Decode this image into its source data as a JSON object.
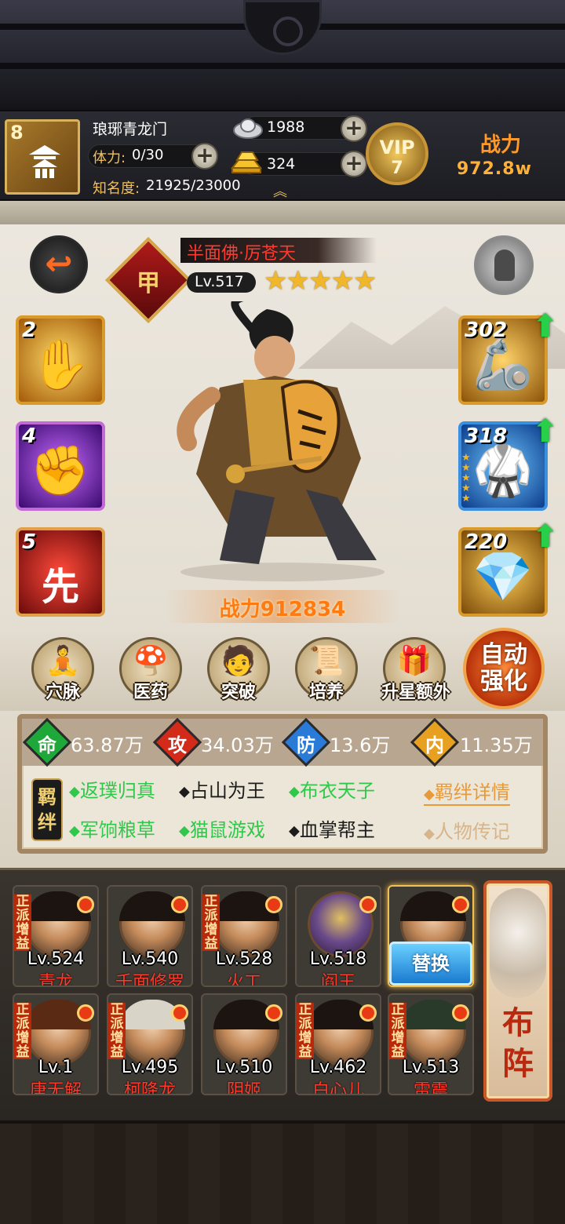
{
  "player": {
    "level": "8",
    "name": "琅琊青龙门",
    "stamina_label": "体力:",
    "stamina_value": "0/30",
    "fame_label": "知名度:",
    "fame_value": "21925/23000"
  },
  "currency": {
    "silver": "1988",
    "gold": "324"
  },
  "vip": {
    "label": "VIP",
    "level": "7"
  },
  "header_power": {
    "label": "战力",
    "value": "972.8w"
  },
  "hero": {
    "rank": "甲",
    "name": "半面佛·厉苍天",
    "level": "Lv.517",
    "stars": 5,
    "power": "战力912834"
  },
  "skills": [
    {
      "level": "2",
      "icon": "palm-icon",
      "glyph": "✋"
    },
    {
      "level": "4",
      "icon": "fist-icon",
      "glyph": "✊"
    },
    {
      "level": "5",
      "icon": "first-strike-icon",
      "glyph": "先"
    }
  ],
  "equipment": [
    {
      "level": "302",
      "icon": "gauntlet-icon",
      "glyph": "🦾"
    },
    {
      "level": "318",
      "icon": "robe-icon",
      "glyph": "🥋"
    },
    {
      "level": "220",
      "icon": "gems-icon",
      "glyph": "💎"
    }
  ],
  "functions": [
    {
      "label": "穴脉",
      "icon": "meridian-icon",
      "glyph": "🧘"
    },
    {
      "label": "医药",
      "icon": "medicine-icon",
      "glyph": "🍄"
    },
    {
      "label": "突破",
      "icon": "breakthrough-icon",
      "glyph": "🧑"
    },
    {
      "label": "培养",
      "icon": "cultivate-icon",
      "glyph": "📜"
    },
    {
      "label": "升星额外",
      "icon": "star-upgrade-icon",
      "glyph": "🎁"
    }
  ],
  "auto_enhance": {
    "line1": "自动",
    "line2": "强化"
  },
  "stats": [
    {
      "icon": "命",
      "value": "63.87万",
      "color": "#1fa83a"
    },
    {
      "icon": "攻",
      "value": "34.03万",
      "color": "#d42a1a"
    },
    {
      "icon": "防",
      "value": "13.6万",
      "color": "#2a7ad8"
    },
    {
      "icon": "内",
      "value": "11.35万",
      "color": "#e8a020"
    }
  ],
  "bonds": {
    "badge_top": "羁",
    "badge_bottom": "绊",
    "items": [
      {
        "text": "返璞归真",
        "active": true
      },
      {
        "text": "占山为王",
        "active": false
      },
      {
        "text": "布衣天子",
        "active": true
      },
      {
        "text": "军饷粮草",
        "active": true
      },
      {
        "text": "猫鼠游戏",
        "active": true
      },
      {
        "text": "血掌帮主",
        "active": false
      }
    ],
    "details_link": "羁绊详情",
    "biography_link": "人物传记"
  },
  "team": [
    {
      "level": "Lv.524",
      "name": "青龙",
      "tag": "正派增益"
    },
    {
      "level": "Lv.540",
      "name": "千面修罗",
      "tag": ""
    },
    {
      "level": "Lv.528",
      "name": "火工",
      "tag": "正派增益"
    },
    {
      "level": "Lv.518",
      "name": "阎王",
      "tag": ""
    },
    {
      "level": "",
      "name": "",
      "tag": ""
    },
    {
      "level": "Lv.1",
      "name": "唐无解",
      "tag": "正派增益"
    },
    {
      "level": "Lv.495",
      "name": "柯降龙",
      "tag": "正派增益"
    },
    {
      "level": "Lv.510",
      "name": "阴姬",
      "tag": ""
    },
    {
      "level": "Lv.462",
      "name": "白心儿",
      "tag": "正派增益"
    },
    {
      "level": "Lv.513",
      "name": "雷震",
      "tag": "正派增益"
    }
  ],
  "swap_button": "替换",
  "deploy_button": {
    "line1": "布",
    "line2": "阵"
  }
}
